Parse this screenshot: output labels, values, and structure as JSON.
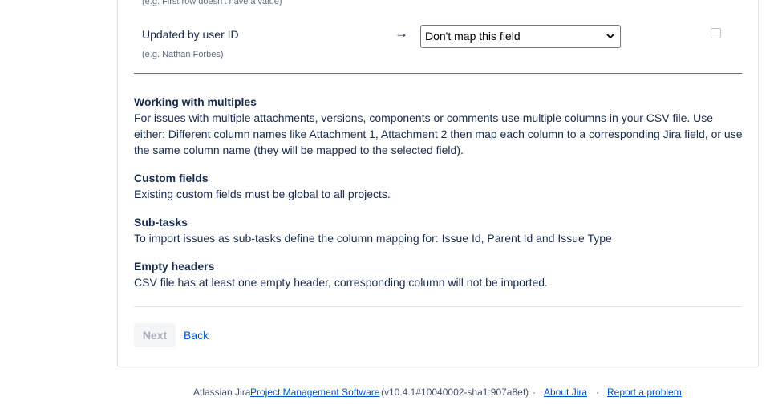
{
  "mapping": {
    "prev_hint": "(e.g. First row doesn't have a value)",
    "field_label": "Updated by user ID",
    "field_hint": "(e.g. Nathan Forbes)",
    "arrow": "→",
    "select_value": "Don't map this field",
    "select_chevron": "⌄"
  },
  "info": [
    {
      "heading": "Working with multiples",
      "text": "For issues with multiple attachments, versions, components or comments use multiple columns in your CSV file. Use either: Different column names like Attachment 1, Attachment 2 then map each column to a corresponding Jira field, or use the same column name (they will be mapped to the selected field)."
    },
    {
      "heading": "Custom fields",
      "text": "Existing custom fields must be global to all projects."
    },
    {
      "heading": "Sub-tasks",
      "text": "To import issues as sub-tasks define the column mapping for: Issue Id, Parent Id and Issue Type"
    },
    {
      "heading": "Empty headers",
      "text": "CSV file has at least one empty header, corresponding column will not be imported."
    }
  ],
  "actions": {
    "next_label": "Next",
    "back_label": "Back"
  },
  "footer": {
    "prefix": "Atlassian Jira",
    "pm_link": "Project Management Software",
    "version": "(v10.4.1#10040002-sha1:907a8ef)",
    "sep": "·",
    "about": "About Jira",
    "report": "Report a problem"
  }
}
